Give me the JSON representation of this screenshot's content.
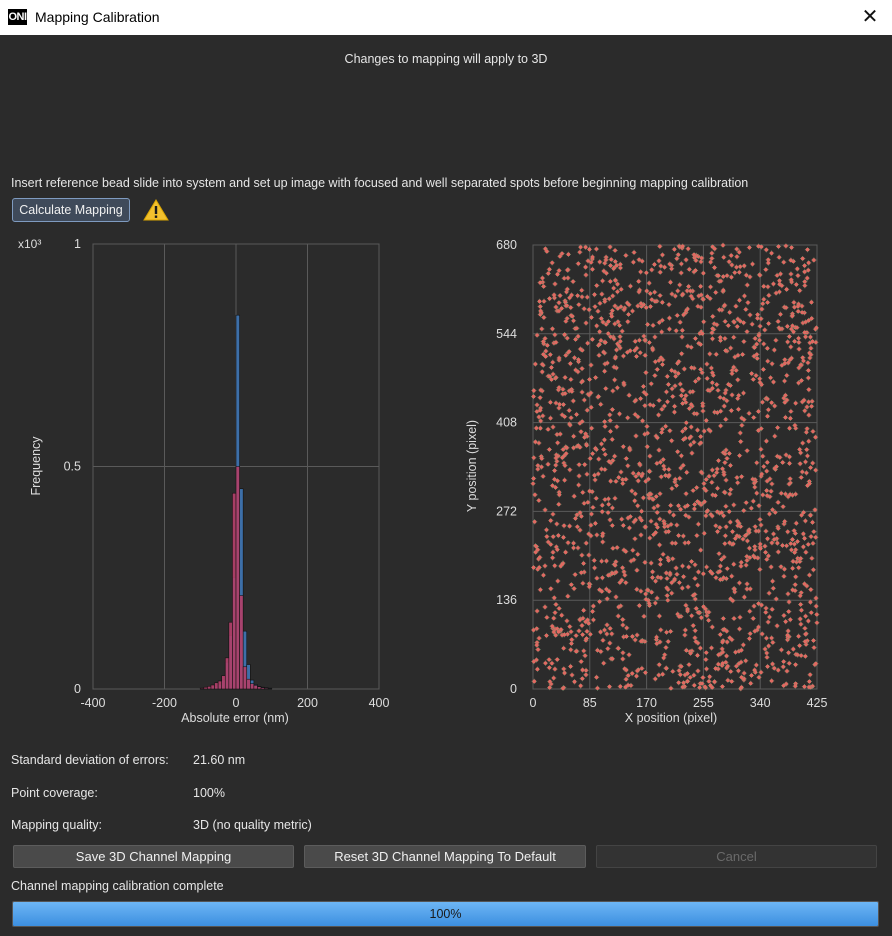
{
  "window": {
    "title": "Mapping Calibration",
    "logo_text": "ONI"
  },
  "notice": "Changes to mapping will apply to 3D",
  "instructions": "Insert reference bead slide into system and set up image with focused and well separated spots before beginning mapping calibration",
  "calculate_button": "Calculate Mapping",
  "colors": {
    "background": "#2b2b2b",
    "blue_bars": "#3d6fa8",
    "pink_bars": "#b2406a",
    "scatter_point": "#e06a62",
    "progress": "#3c8fe0"
  },
  "chart_data": [
    {
      "type": "bar",
      "xlabel": "Absolute error (nm)",
      "ylabel": "Frequency",
      "y_multiplier": "x10³",
      "xlim": [
        -400,
        400
      ],
      "ylim": [
        0,
        1
      ],
      "xticks": [
        "-400",
        "-200",
        "0",
        "200",
        "400"
      ],
      "yticks": [
        "0",
        "0.5",
        "1"
      ],
      "grid": true,
      "bin_width": 10,
      "series": [
        {
          "color": "#3d6fa8",
          "bins": [
            -100,
            -90,
            -80,
            -70,
            -60,
            -50,
            -40,
            -30,
            -20,
            -10,
            0,
            10,
            20,
            30,
            40,
            50,
            60,
            70,
            80,
            90
          ],
          "values": [
            0.001,
            0.002,
            0.003,
            0.004,
            0.006,
            0.01,
            0.02,
            0.06,
            0.12,
            0.25,
            0.84,
            0.45,
            0.13,
            0.055,
            0.02,
            0.01,
            0.006,
            0.004,
            0.003,
            0.002
          ]
        },
        {
          "color": "#b2406a",
          "bins": [
            -100,
            -90,
            -80,
            -70,
            -60,
            -50,
            -40,
            -30,
            -20,
            -10,
            0,
            10,
            20,
            30,
            40,
            50,
            60,
            70,
            80,
            90
          ],
          "values": [
            0.002,
            0.004,
            0.006,
            0.009,
            0.014,
            0.018,
            0.03,
            0.07,
            0.15,
            0.44,
            0.5,
            0.21,
            0.05,
            0.022,
            0.012,
            0.008,
            0.005,
            0.003,
            0.002,
            0.001
          ]
        }
      ]
    },
    {
      "type": "scatter",
      "xlabel": "X position (pixel)",
      "ylabel": "Y position (pixel)",
      "xlim": [
        0,
        425
      ],
      "ylim": [
        0,
        680
      ],
      "xticks": [
        "0",
        "85",
        "170",
        "255",
        "340",
        "425"
      ],
      "yticks": [
        "0",
        "136",
        "272",
        "408",
        "544",
        "680"
      ],
      "grid": true,
      "point_color": "#e06a62",
      "point_count": 1800
    }
  ],
  "stats": {
    "std_label": "Standard deviation of errors:",
    "std_value": "21.60 nm",
    "coverage_label": "Point coverage:",
    "coverage_value": "100%",
    "quality_label": "Mapping quality:",
    "quality_value": "3D (no quality metric)"
  },
  "buttons": {
    "save": "Save 3D Channel Mapping",
    "reset": "Reset 3D Channel Mapping To Default",
    "cancel": "Cancel"
  },
  "status": "Channel mapping calibration complete",
  "progress": {
    "value": 100,
    "label": "100%"
  }
}
